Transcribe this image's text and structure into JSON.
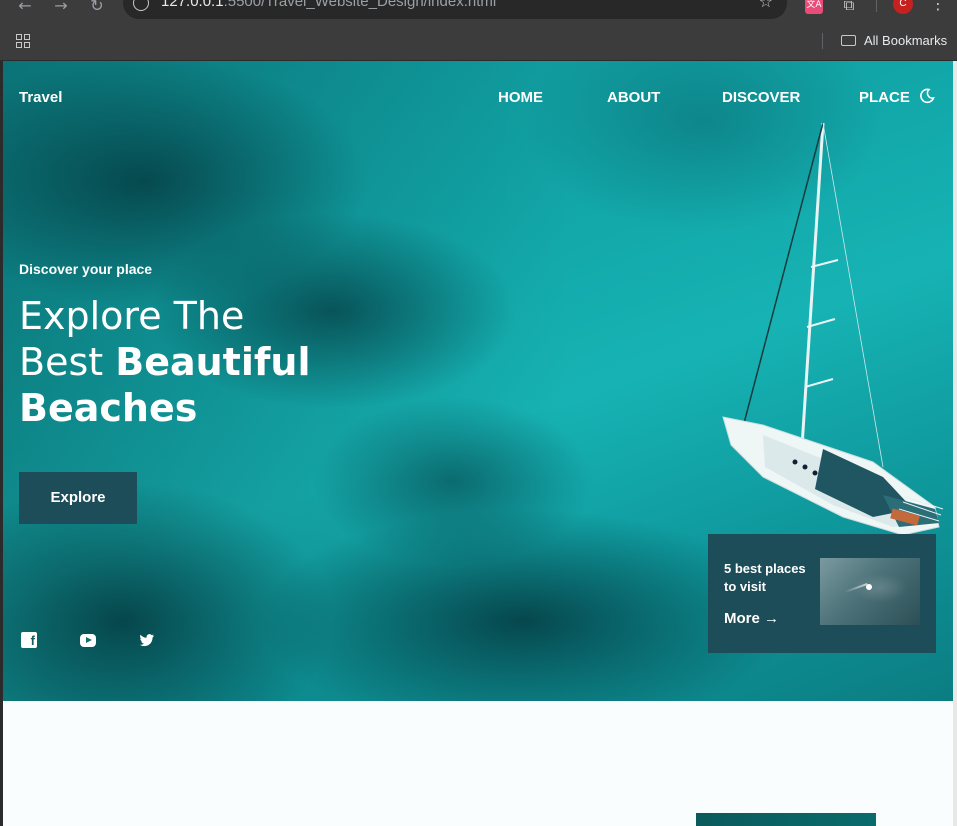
{
  "browser": {
    "url_host": "127.0.0.1",
    "url_rest": ":5500/Travel_Website_Design/index.html",
    "bookmarks_label": "All Bookmarks",
    "avatar_letter": "C",
    "translate_ext_label": "文A"
  },
  "nav": {
    "logo": "Travel",
    "items": [
      {
        "label": "HOME"
      },
      {
        "label": "ABOUT"
      },
      {
        "label": "DISCOVER"
      },
      {
        "label": "PLACE"
      }
    ],
    "theme_icon": "moon-icon"
  },
  "hero": {
    "subtitle": "Discover your place",
    "title_line1": "Explore The",
    "title_line2_light": "Best ",
    "title_line2_bold": "Beautiful",
    "title_line3": "Beaches",
    "cta_label": "Explore"
  },
  "social": [
    {
      "name": "facebook-icon"
    },
    {
      "name": "youtube-icon"
    },
    {
      "name": "twitter-icon"
    }
  ],
  "card": {
    "title": "5 best places to visit",
    "more_label": "More",
    "arrow": "→"
  },
  "colors": {
    "accent": "#1c4d58",
    "water": "#12a6a8",
    "page_bg": "#f9fdfe"
  }
}
